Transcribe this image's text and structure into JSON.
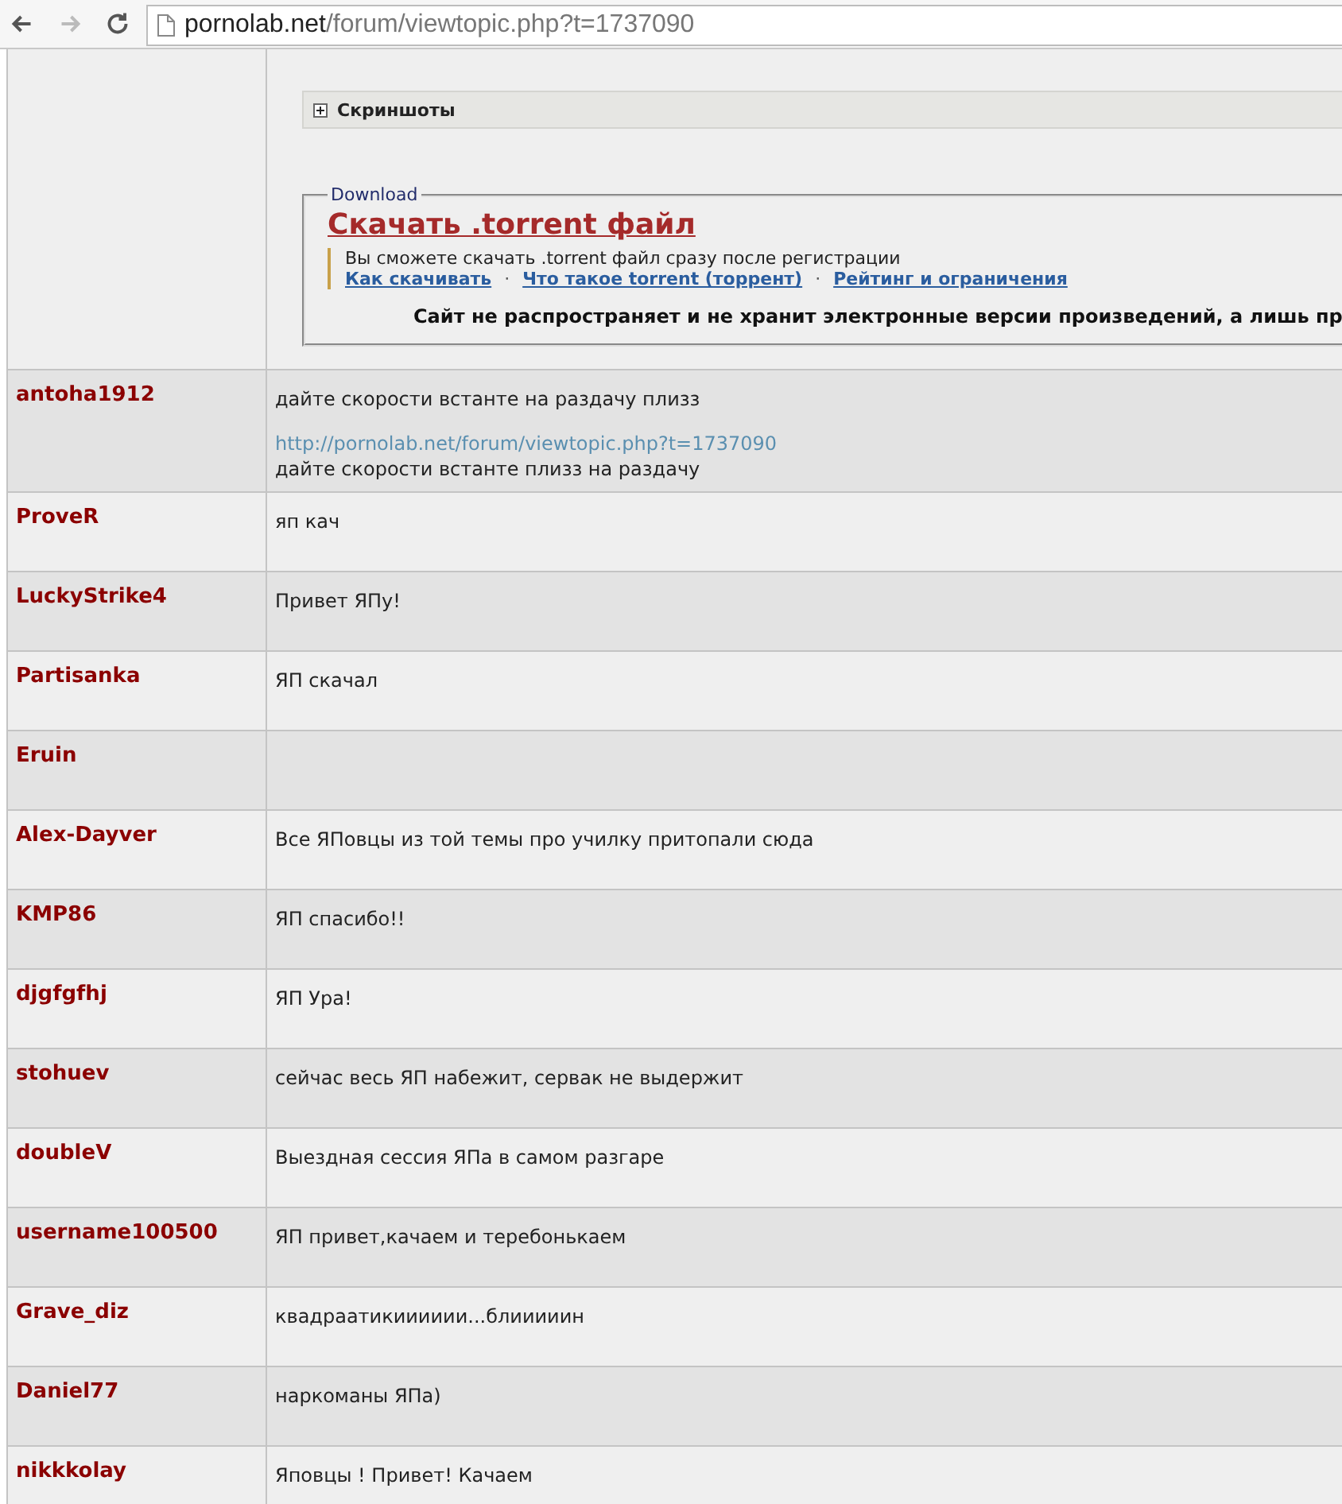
{
  "browser": {
    "back_disabled": false,
    "forward_disabled": true,
    "url_host": "pornolab.net",
    "url_path": "/forum/viewtopic.php?t=1737090"
  },
  "first_post": {
    "spoiler": {
      "label": "Скриншоты",
      "expanded": false
    },
    "download": {
      "legend": "Download",
      "link": "Скачать .torrent файл",
      "note": "Вы сможете скачать .torrent файл сразу после регистрации",
      "links": [
        "Как скачивать",
        "Что такое torrent (торрент)",
        "Рейтинг и ограничения"
      ],
      "separator": "·",
      "disclaimer": "Сайт не распространяет и не хранит электронные версии произведений, а лишь пр"
    }
  },
  "posts": [
    {
      "author": "antoha1912",
      "body": [
        {
          "kind": "text",
          "text": "дайте скорости встанте на раздачу плизз"
        },
        {
          "kind": "link",
          "text": "http://pornolab.net/forum/viewtopic.php?t=1737090"
        },
        {
          "kind": "text",
          "text": "дайте скорости встанте плизз на раздачу"
        }
      ]
    },
    {
      "author": "ProveR",
      "body": [
        {
          "kind": "text",
          "text": "яп кач"
        }
      ]
    },
    {
      "author": "LuckyStrike4",
      "body": [
        {
          "kind": "text",
          "text": "Привет ЯПу!"
        }
      ]
    },
    {
      "author": "Partisanka",
      "body": [
        {
          "kind": "text",
          "text": "ЯП скачал"
        }
      ]
    },
    {
      "author": "Eruin"
    },
    {
      "author": "Alex-Dayver",
      "body": [
        {
          "kind": "text",
          "text": "Все ЯПовцы из той темы про училку притопали сюда"
        }
      ]
    },
    {
      "author": "KMP86",
      "body": [
        {
          "kind": "text",
          "text": "ЯП спасибо!!"
        }
      ]
    },
    {
      "author": "djgfgfhj",
      "body": [
        {
          "kind": "text",
          "text": "ЯП Ура!"
        }
      ]
    },
    {
      "author": "stohuev",
      "body": [
        {
          "kind": "text",
          "text": "сейчас весь ЯП набежит, сервак не выдержит"
        }
      ]
    },
    {
      "author": "doubleV",
      "body": [
        {
          "kind": "text",
          "text": "Выездная сессия ЯПа в самом разгаре"
        }
      ]
    },
    {
      "author": "username100500",
      "body": [
        {
          "kind": "text",
          "text": "ЯП привет,качаем и теребонькаем"
        }
      ]
    },
    {
      "author": "Grave_diz",
      "body": [
        {
          "kind": "text",
          "text": "квадраатикииииии...блииииин"
        }
      ]
    },
    {
      "author": "Daniel77",
      "body": [
        {
          "kind": "text",
          "text": "наркоманы ЯПа)"
        }
      ]
    },
    {
      "author": "nikkkolay",
      "body": [
        {
          "kind": "text",
          "text": "Яповцы ! Привет! Качаем"
        }
      ]
    }
  ]
}
